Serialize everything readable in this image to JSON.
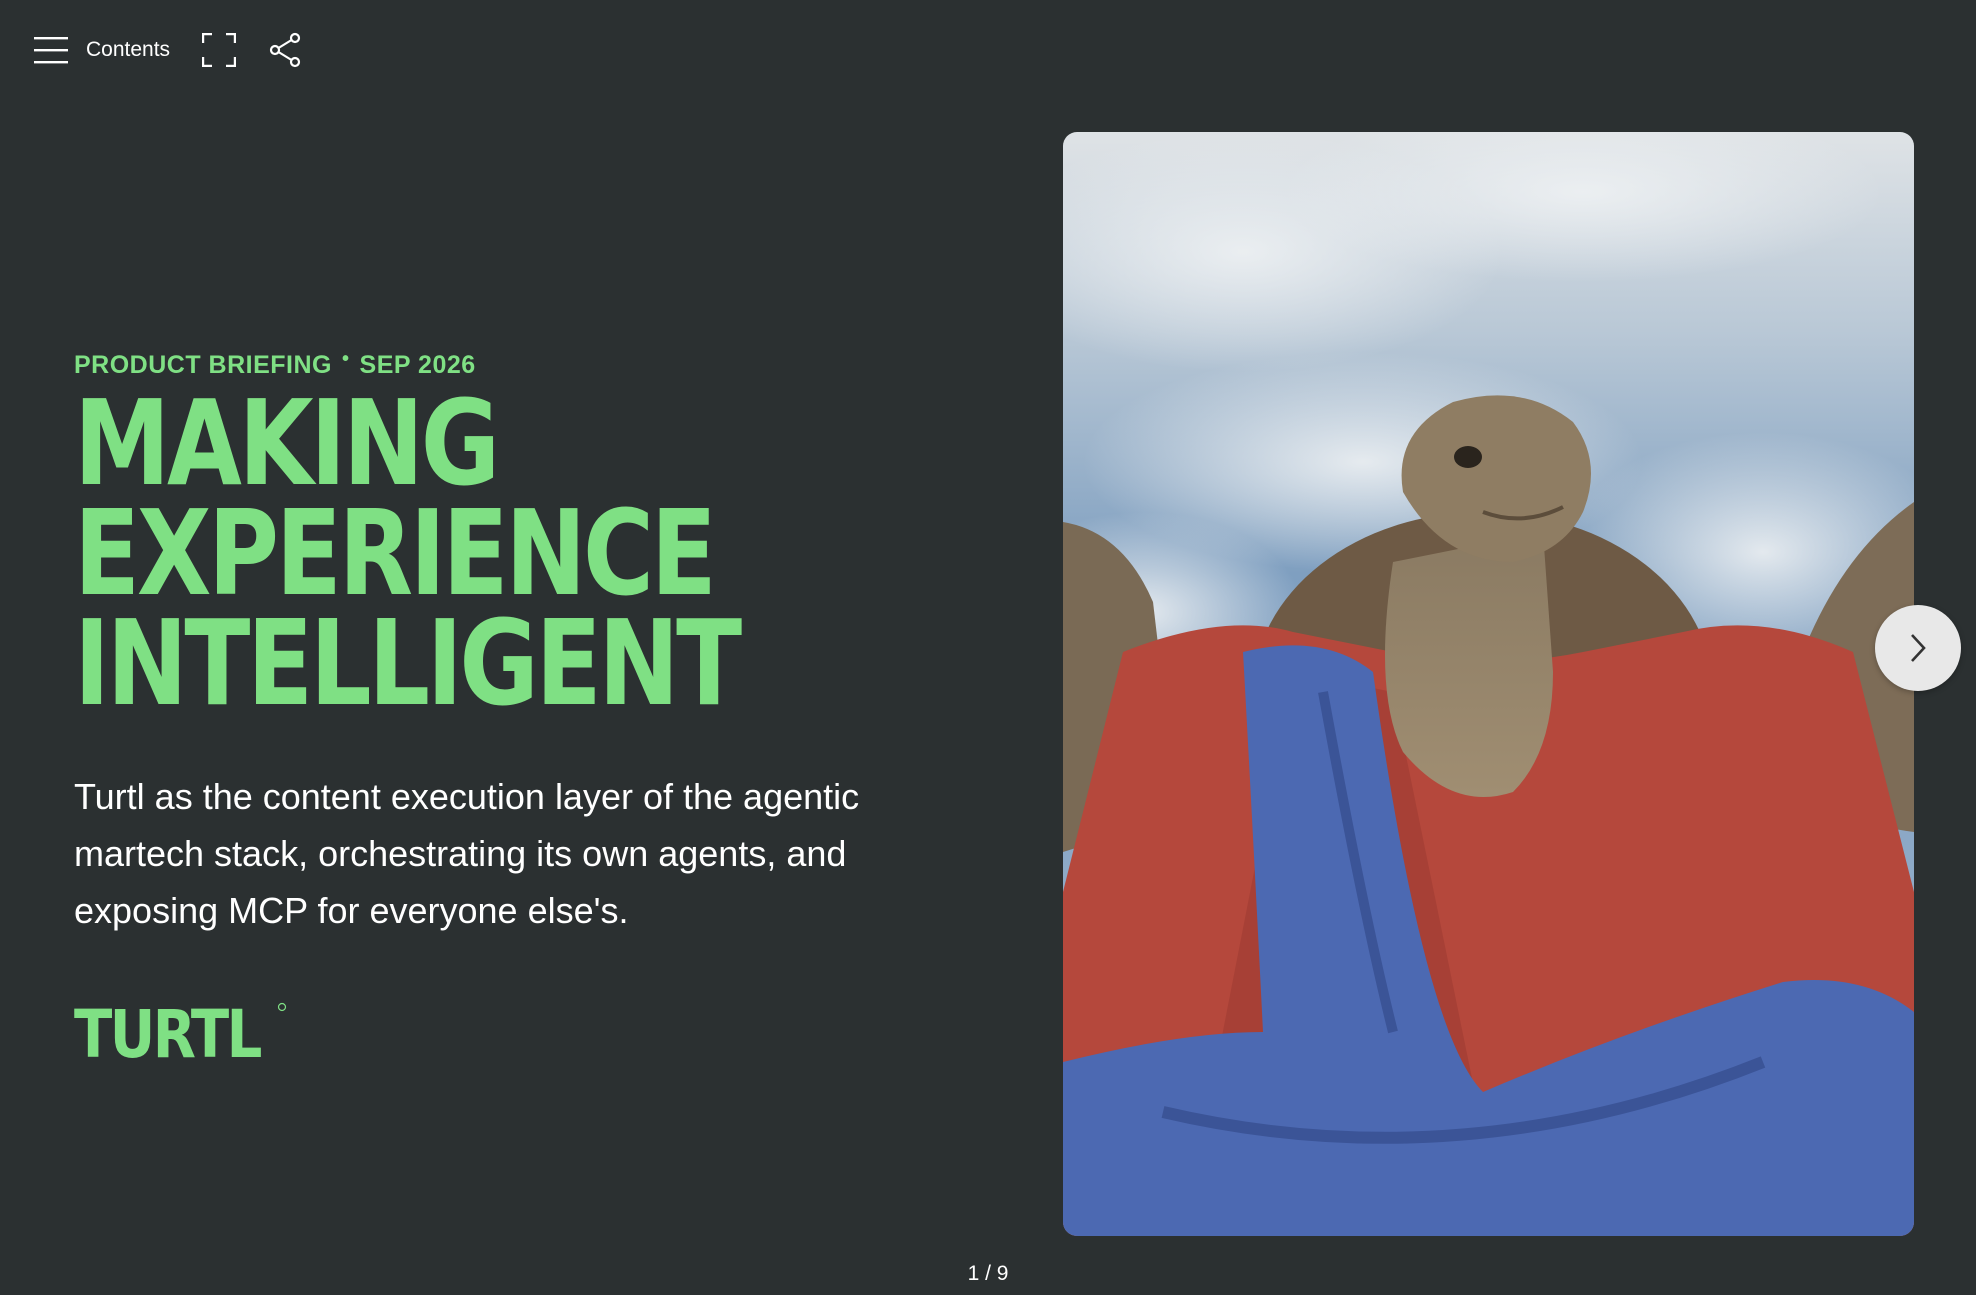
{
  "toolbar": {
    "contents_label": "Contents",
    "menu_icon": "hamburger-icon",
    "fullscreen_icon": "fullscreen-icon",
    "share_icon": "share-icon"
  },
  "hero": {
    "eyebrow_left": "PRODUCT BRIEFING",
    "eyebrow_sep": "•",
    "eyebrow_right": "SEP 2026",
    "headline_lines": [
      "MAKING",
      "EXPERIENCE",
      "INTELLIGENT"
    ],
    "description": "Turtl as the content execution layer of the agentic martech stack, orchestrating its own agents, and exposing MCP for everyone else's.",
    "logo_text": "TURTL"
  },
  "image": {
    "description_icon": "tortoise-superhero-photo"
  },
  "navigation": {
    "next_icon": "chevron-right-icon",
    "current_page": "1",
    "total_pages": "9",
    "pager_text": "1 / 9"
  },
  "colors": {
    "background": "#2b3031",
    "accent": "#7fe084",
    "text": "#ffffff"
  }
}
